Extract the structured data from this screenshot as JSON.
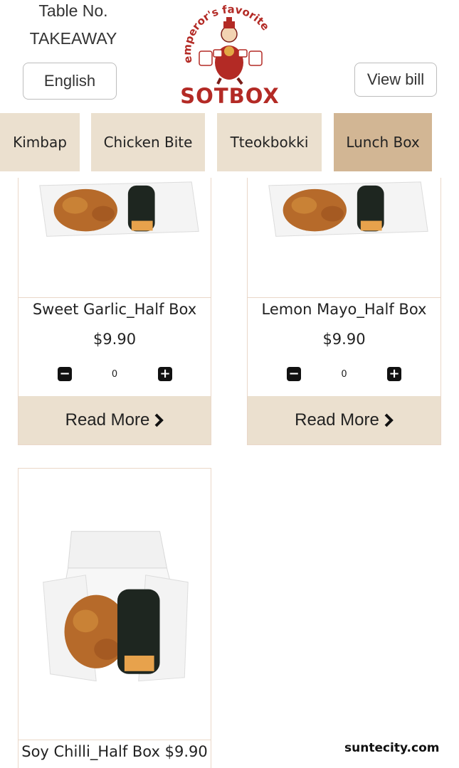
{
  "header": {
    "table_label": "Table No.",
    "table_value": "TAKEAWAY",
    "language_button": "English",
    "view_bill_button": "View bill",
    "logo": {
      "tagline": "emperor's favorite",
      "brand": "SOTBOX"
    }
  },
  "categories": [
    {
      "label": "Kimbap",
      "active": false
    },
    {
      "label": "Chicken Bite",
      "active": false
    },
    {
      "label": "Tteokbokki",
      "active": false
    },
    {
      "label": "Lunch Box",
      "active": true
    }
  ],
  "products": [
    {
      "name": "Sweet Garlic_Half Box",
      "price": "$9.90",
      "quantity": "0",
      "read_more": "Read More"
    },
    {
      "name": "Lemon Mayo_Half Box",
      "price": "$9.90",
      "quantity": "0",
      "read_more": "Read More"
    },
    {
      "name": "Soy Chilli_Half Box",
      "price": "$9.90"
    }
  ],
  "watermark": "suntecity.com",
  "colors": {
    "tab_inactive": "#ebe0cf",
    "tab_active": "#d2b694",
    "brand_red": "#b32a25",
    "card_border": "#ead7c8"
  },
  "icons": {
    "qty_decrease": "minus-square-icon",
    "qty_increase": "plus-square-icon",
    "read_more": "chevron-right-icon"
  }
}
